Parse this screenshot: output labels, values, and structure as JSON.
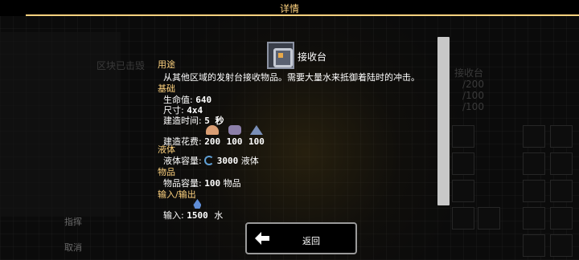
{
  "header": {
    "title": "详情"
  },
  "block": {
    "name": "接收台",
    "icon": "unloader-block-icon"
  },
  "sections": {
    "usage": {
      "title": "用途",
      "text": "从其他区域的发射台接收物品。需要大量水来抵御着陆时的冲击。"
    },
    "base": {
      "title": "基础",
      "health_label": "生命值:",
      "health": "640",
      "size_label": "尺寸:",
      "size": "4x4",
      "build_time_label": "建造时间:",
      "build_time": "5 秒",
      "build_cost_label": "建造花费:",
      "costs": [
        {
          "icon": "copper-icon",
          "amount": "200"
        },
        {
          "icon": "lead-icon",
          "amount": "100"
        },
        {
          "icon": "graphite-icon",
          "amount": "100"
        }
      ]
    },
    "liquid": {
      "title": "液体",
      "capacity_label": "液体容量:",
      "capacity": "3000",
      "unit": "液体",
      "icon": "liquid-icon"
    },
    "items": {
      "title": "物品",
      "capacity_label": "物品容量:",
      "capacity": "100",
      "unit": "物品"
    },
    "io": {
      "title": "输入/输出",
      "input_label": "输入:",
      "input_amount": "1500",
      "input_unit": "水",
      "input_icon": "water-icon"
    }
  },
  "back_button": {
    "label": "返回",
    "icon": "arrow-left-icon"
  },
  "background": {
    "left_top_label": "区块已击毁",
    "left_bottom_label_1": "指挥",
    "left_bottom_label_2": "取消",
    "right_label": "接收台",
    "right_val_1": "/200",
    "right_val_2": "/100",
    "right_val_3": "/100"
  },
  "colors": {
    "accent": "#ffd37f",
    "text": "#ffffff",
    "background": "#000000"
  }
}
